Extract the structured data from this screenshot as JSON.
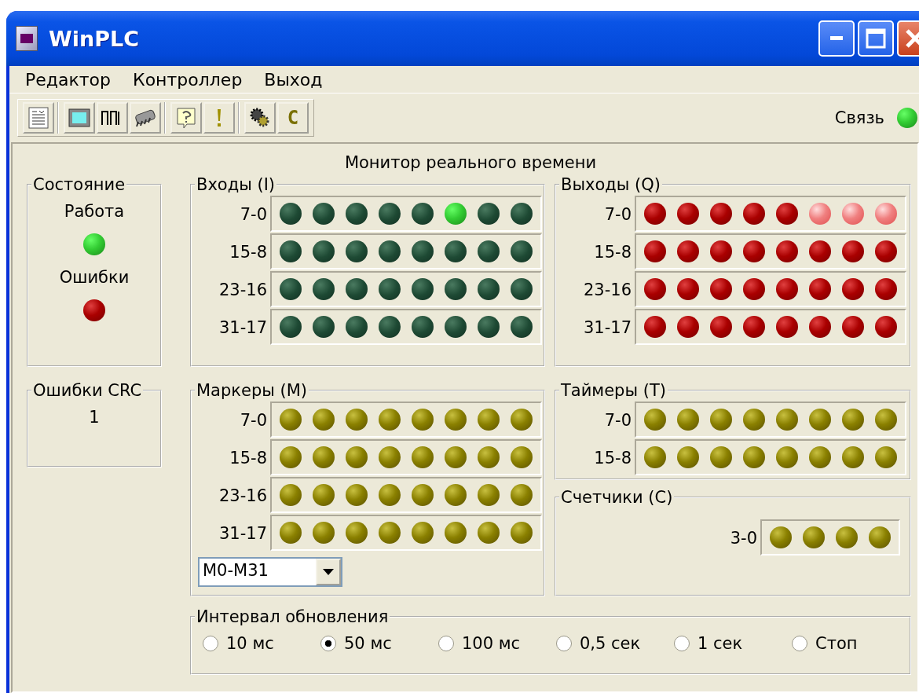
{
  "window": {
    "title": "WinPLC"
  },
  "menu": [
    {
      "label": "Редактор"
    },
    {
      "label": "Контроллер"
    },
    {
      "label": "Выход"
    }
  ],
  "toolbar": [
    [
      {
        "kind": "document"
      }
    ],
    [
      {
        "kind": "screen"
      },
      {
        "kind": "pulse"
      },
      {
        "kind": "chip"
      }
    ],
    [
      {
        "kind": "help"
      },
      {
        "kind": "exclaim"
      }
    ],
    [
      {
        "kind": "gears"
      },
      {
        "kind": "letter",
        "text": "C"
      }
    ]
  ],
  "connection": {
    "label": "Связь",
    "on": true
  },
  "monitor_title": "Монитор реального времени",
  "status": {
    "title": "Состояние",
    "items": [
      {
        "label": "Работа",
        "kind": "run",
        "on": true
      },
      {
        "label": "Ошибки",
        "kind": "error",
        "on": false
      }
    ]
  },
  "crc": {
    "title": "Ошибки CRC",
    "value": "1"
  },
  "inputs": {
    "title": "Входы (I)",
    "kind": "green",
    "rows": [
      {
        "label": "7-0",
        "leds": [
          {
            "on": false
          },
          {
            "on": false
          },
          {
            "on": false
          },
          {
            "on": false
          },
          {
            "on": false
          },
          {
            "on": true
          },
          {
            "on": false
          },
          {
            "on": false
          }
        ]
      },
      {
        "label": "15-8",
        "leds": [
          {
            "on": false
          },
          {
            "on": false
          },
          {
            "on": false
          },
          {
            "on": false
          },
          {
            "on": false
          },
          {
            "on": false
          },
          {
            "on": false
          },
          {
            "on": false
          }
        ]
      },
      {
        "label": "23-16",
        "leds": [
          {
            "on": false
          },
          {
            "on": false
          },
          {
            "on": false
          },
          {
            "on": false
          },
          {
            "on": false
          },
          {
            "on": false
          },
          {
            "on": false
          },
          {
            "on": false
          }
        ]
      },
      {
        "label": "31-17",
        "leds": [
          {
            "on": false
          },
          {
            "on": false
          },
          {
            "on": false
          },
          {
            "on": false
          },
          {
            "on": false
          },
          {
            "on": false
          },
          {
            "on": false
          },
          {
            "on": false
          }
        ]
      }
    ]
  },
  "outputs": {
    "title": "Выходы (Q)",
    "kind": "red",
    "rows": [
      {
        "label": "7-0",
        "leds": [
          {
            "on": false
          },
          {
            "on": false
          },
          {
            "on": false
          },
          {
            "on": false
          },
          {
            "on": false
          },
          {
            "on": true
          },
          {
            "on": true
          },
          {
            "on": true
          }
        ]
      },
      {
        "label": "15-8",
        "leds": [
          {
            "on": false
          },
          {
            "on": false
          },
          {
            "on": false
          },
          {
            "on": false
          },
          {
            "on": false
          },
          {
            "on": false
          },
          {
            "on": false
          },
          {
            "on": false
          }
        ]
      },
      {
        "label": "23-16",
        "leds": [
          {
            "on": false
          },
          {
            "on": false
          },
          {
            "on": false
          },
          {
            "on": false
          },
          {
            "on": false
          },
          {
            "on": false
          },
          {
            "on": false
          },
          {
            "on": false
          }
        ]
      },
      {
        "label": "31-17",
        "leds": [
          {
            "on": false
          },
          {
            "on": false
          },
          {
            "on": false
          },
          {
            "on": false
          },
          {
            "on": false
          },
          {
            "on": false
          },
          {
            "on": false
          },
          {
            "on": false
          }
        ]
      }
    ]
  },
  "markers": {
    "title": "Маркеры (M)",
    "kind": "yellow",
    "select": {
      "value": "M0-M31"
    },
    "rows": [
      {
        "label": "7-0",
        "leds": [
          {
            "on": false
          },
          {
            "on": false
          },
          {
            "on": false
          },
          {
            "on": false
          },
          {
            "on": false
          },
          {
            "on": false
          },
          {
            "on": false
          },
          {
            "on": false
          }
        ]
      },
      {
        "label": "15-8",
        "leds": [
          {
            "on": false
          },
          {
            "on": false
          },
          {
            "on": false
          },
          {
            "on": false
          },
          {
            "on": false
          },
          {
            "on": false
          },
          {
            "on": false
          },
          {
            "on": false
          }
        ]
      },
      {
        "label": "23-16",
        "leds": [
          {
            "on": false
          },
          {
            "on": false
          },
          {
            "on": false
          },
          {
            "on": false
          },
          {
            "on": false
          },
          {
            "on": false
          },
          {
            "on": false
          },
          {
            "on": false
          }
        ]
      },
      {
        "label": "31-17",
        "leds": [
          {
            "on": false
          },
          {
            "on": false
          },
          {
            "on": false
          },
          {
            "on": false
          },
          {
            "on": false
          },
          {
            "on": false
          },
          {
            "on": false
          },
          {
            "on": false
          }
        ]
      }
    ]
  },
  "timers": {
    "title": "Таймеры (T)",
    "kind": "yellow",
    "rows": [
      {
        "label": "7-0",
        "leds": [
          {
            "on": false
          },
          {
            "on": false
          },
          {
            "on": false
          },
          {
            "on": false
          },
          {
            "on": false
          },
          {
            "on": false
          },
          {
            "on": false
          },
          {
            "on": false
          }
        ]
      },
      {
        "label": "15-8",
        "leds": [
          {
            "on": false
          },
          {
            "on": false
          },
          {
            "on": false
          },
          {
            "on": false
          },
          {
            "on": false
          },
          {
            "on": false
          },
          {
            "on": false
          },
          {
            "on": false
          }
        ]
      }
    ]
  },
  "counters": {
    "title": "Счетчики (C)",
    "kind": "yellow",
    "rows": [
      {
        "label": "3-0",
        "leds": [
          {
            "on": false
          },
          {
            "on": false
          },
          {
            "on": false
          },
          {
            "on": false
          }
        ]
      }
    ]
  },
  "interval": {
    "title": "Интервал обновления",
    "options": [
      {
        "label": "10 мс",
        "selected": false
      },
      {
        "label": "50 мс",
        "selected": true
      },
      {
        "label": "100 мс",
        "selected": false
      },
      {
        "label": "0,5 сек",
        "selected": false
      },
      {
        "label": "1 сек",
        "selected": false
      },
      {
        "label": "Стоп",
        "selected": false
      }
    ]
  }
}
